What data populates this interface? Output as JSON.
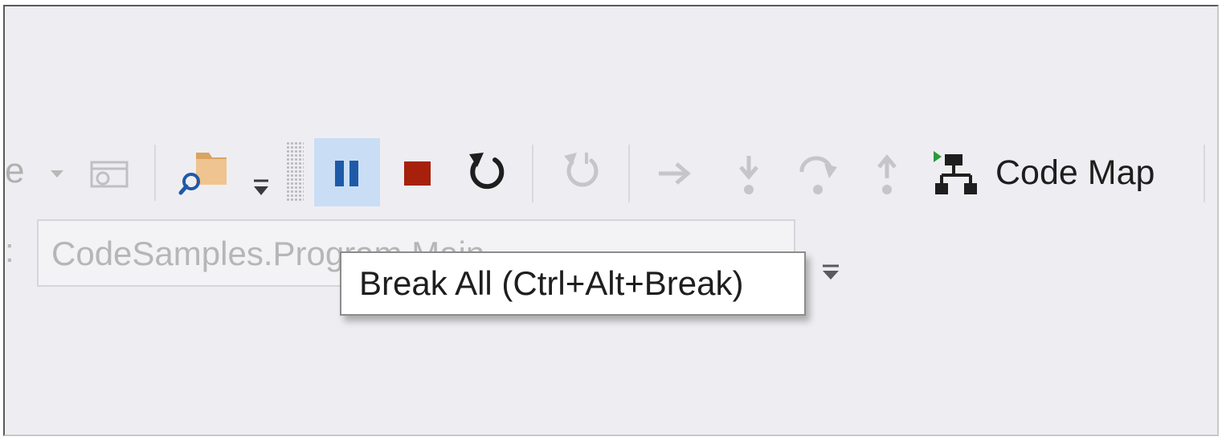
{
  "toolbar": {
    "partial_label": "e",
    "code_map_label": "Code Map",
    "pause_active_color": "#c9def5",
    "stop_color": "#a6200c",
    "icons": [
      "dropdown-arrow-icon",
      "attach-process-icon",
      "find-folder-icon",
      "toolbar-overflow-icon",
      "break-all-icon",
      "stop-debugging-icon",
      "restart-icon",
      "apply-code-changes-icon",
      "show-next-statement-icon",
      "step-into-icon",
      "step-over-icon",
      "step-out-icon",
      "code-map-icon"
    ]
  },
  "location_bar": {
    "colon": ":",
    "value": "CodeSamples.Program.Main"
  },
  "tooltip": {
    "text": "Break All (Ctrl+Alt+Break)"
  }
}
